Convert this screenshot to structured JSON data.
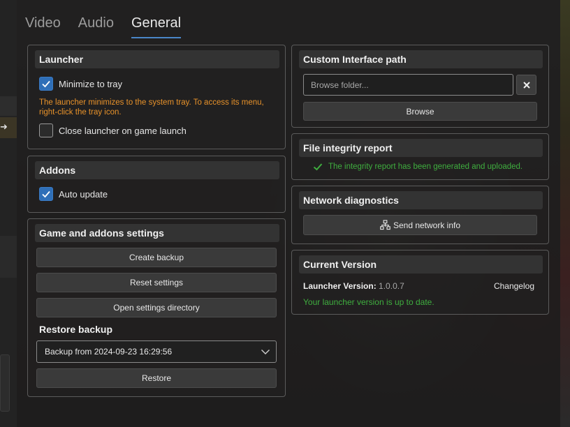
{
  "tabs": [
    {
      "label": "Video"
    },
    {
      "label": "Audio"
    },
    {
      "label": "General"
    }
  ],
  "launcher": {
    "title": "Launcher",
    "minimize_to_tray": {
      "label": "Minimize to tray",
      "checked": true
    },
    "minimize_hint": "The launcher minimizes to the system tray. To access its menu, right-click the tray icon.",
    "close_on_launch": {
      "label": "Close launcher on game launch",
      "checked": false
    }
  },
  "addons": {
    "title": "Addons",
    "auto_update": {
      "label": "Auto update",
      "checked": true
    }
  },
  "game_settings": {
    "title": "Game and addons settings",
    "create_backup": "Create backup",
    "reset_settings": "Reset settings",
    "open_directory": "Open settings directory",
    "restore_title": "Restore backup",
    "backup_selected": "Backup from 2024-09-23 16:29:56",
    "restore": "Restore"
  },
  "custom_interface": {
    "title": "Custom Interface path",
    "placeholder": "Browse folder...",
    "browse": "Browse"
  },
  "file_integrity": {
    "title": "File integrity report",
    "status": "The integrity report has been generated and uploaded."
  },
  "network": {
    "title": "Network diagnostics",
    "send": "Send network info"
  },
  "version": {
    "title": "Current Version",
    "label": "Launcher Version:",
    "value": "1.0.0.7",
    "changelog": "Changelog",
    "status": "Your launcher version is up to date."
  },
  "colors": {
    "accent": "#2f6fb8",
    "warning": "#e8922a",
    "success": "#3fae3f"
  }
}
